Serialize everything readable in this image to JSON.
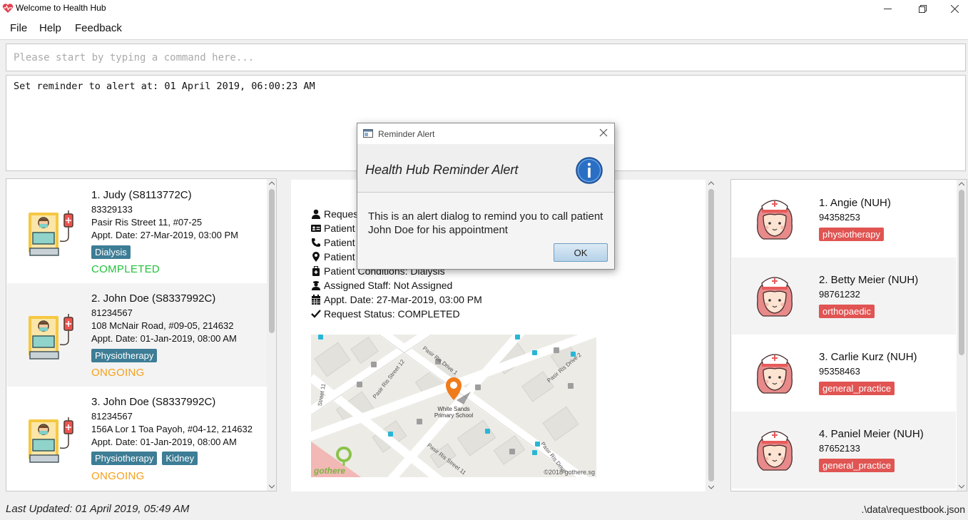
{
  "window": {
    "title": "Welcome to Health Hub"
  },
  "menu": [
    "File",
    "Help",
    "Feedback"
  ],
  "command": {
    "placeholder": "Please start by typing a command here..."
  },
  "result": {
    "text": "Set reminder to alert at: 01 April 2019, 06:00:23 AM"
  },
  "requests": [
    {
      "title": "1.  Judy (S8113772C)",
      "phone": "83329133",
      "address": "Pasir Ris Street 11, #07-25",
      "appt": "Appt. Date: 27-Mar-2019, 03:00 PM",
      "tags": [
        "Dialysis"
      ],
      "status": "COMPLETED",
      "status_color": "#22c33a"
    },
    {
      "title": "2.  John Doe (S8337992C)",
      "phone": "81234567",
      "address": "108 McNair Road, #09-05, 214632",
      "appt": "Appt. Date: 01-Jan-2019, 08:00 AM",
      "tags": [
        "Physiotherapy"
      ],
      "status": "ONGOING",
      "status_color": "#f5a01a"
    },
    {
      "title": "3.  John Doe (S8337992C)",
      "phone": "81234567",
      "address": "156A Lor 1 Toa Payoh, #04-12, 214632",
      "appt": "Appt. Date: 01-Jan-2019, 08:00 AM",
      "tags": [
        "Physiotherapy",
        "Kidney"
      ],
      "status": "ONGOING",
      "status_color": "#f5a01a"
    }
  ],
  "details": {
    "rows": [
      {
        "icon": "user-icon",
        "text": "Reques"
      },
      {
        "icon": "id-card-icon",
        "text": "Patient"
      },
      {
        "icon": "phone-icon",
        "text": "Patient"
      },
      {
        "icon": "map-marker-icon",
        "text": "Patient"
      },
      {
        "icon": "medkit-icon",
        "text": "Patient Conditions: Dialysis"
      },
      {
        "icon": "staff-icon",
        "text": "Assigned Staff: Not Assigned"
      },
      {
        "icon": "calendar-icon",
        "text": "Appt. Date: 27-Mar-2019, 03:00 PM"
      },
      {
        "icon": "check-icon",
        "text": "Request Status: COMPLETED"
      }
    ],
    "map": {
      "poi": "White Sands Primary School",
      "credit": "©2018 gothere.sg",
      "logo": "gothere",
      "roads": [
        "Pasir Ris Street 12",
        "Pasir Ris Drive 1",
        "Pasir Ris Drive 2",
        "Pasir Ris Street 11",
        "Pasir Ris Drive",
        "Street 11"
      ]
    }
  },
  "staff": [
    {
      "name": "1.  Angie (NUH)",
      "phone": "94358253",
      "tag": "physiotherapy"
    },
    {
      "name": "2.  Betty Meier (NUH)",
      "phone": "98761232",
      "tag": "orthopaedic"
    },
    {
      "name": "3.  Carlie Kurz (NUH)",
      "phone": "95358463",
      "tag": "general_practice"
    },
    {
      "name": "4.  Paniel Meier (NUH)",
      "phone": "87652133",
      "tag": "general_practice"
    }
  ],
  "statusbar": {
    "last_updated": "Last Updated: 01 April 2019, 05:49 AM",
    "file": ".\\data\\requestbook.json"
  },
  "dialog": {
    "title": "Reminder Alert",
    "header": "Health Hub Reminder Alert",
    "body": "This is an alert dialog to remind you to call patient John Doe for his appointment",
    "ok": "OK"
  },
  "colors": {
    "tag_blue": "#3d7d95",
    "tag_red": "#e05452",
    "completed": "#22c33a",
    "ongoing": "#f5a01a"
  }
}
